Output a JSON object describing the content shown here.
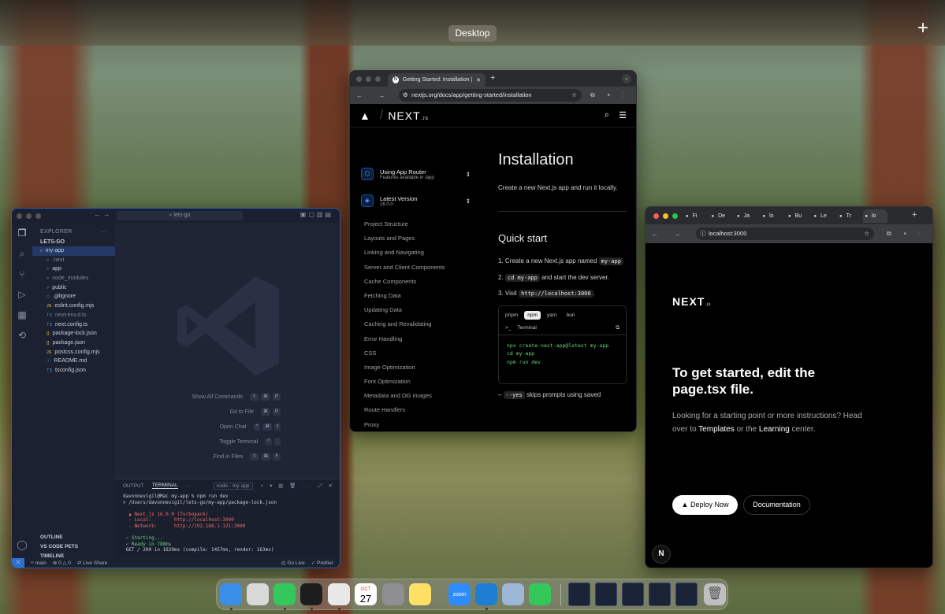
{
  "desktop": {
    "label": "Desktop",
    "plus": "+"
  },
  "vscode": {
    "search": "lets-go",
    "explorer_title": "EXPLORER",
    "root": "LETS-GO",
    "tree": [
      "my-app",
      ".next",
      "app",
      "node_modules",
      "public",
      ".gitignore",
      "eslint.config.mjs",
      "next-env.d.ts",
      "next.config.ts",
      "package-lock.json",
      "package.json",
      "postcss.config.mjs",
      "README.md",
      "tsconfig.json"
    ],
    "tree_icons": [
      "v",
      ">",
      ">",
      ">",
      ">",
      "◇",
      "JS",
      "TS",
      "TS",
      "{}",
      "{}",
      "JS",
      "ⓘ",
      "TS"
    ],
    "shortcuts": [
      {
        "label": "Show All Commands",
        "keys": [
          "⇧",
          "⌘",
          "P"
        ]
      },
      {
        "label": "Go to File",
        "keys": [
          "⌘",
          "P"
        ]
      },
      {
        "label": "Open Chat",
        "keys": [
          "^",
          "⌘",
          "I"
        ]
      },
      {
        "label": "Toggle Terminal",
        "keys": [
          "^",
          "`"
        ]
      },
      {
        "label": "Find in Files",
        "keys": [
          "⇧",
          "⌘",
          "F"
        ]
      }
    ],
    "panel_tabs": {
      "output": "OUTPUT",
      "terminal": "TERMINAL",
      "more": "···",
      "term_name": "node - my-app"
    },
    "terminal_lines": [
      "davonnevigil@Mac my-app % npm run dev",
      "> /Users/davonnevigil/lets-go/my-app/package-lock.json",
      "",
      "  ▲ Next.js 16.0.0 (Turbopack)",
      "  - Local:        http://localhost:3000",
      "  - Network:      http://192.168.1.121:3000",
      "",
      " ✓ Starting...",
      " ✓ Ready in 788ms",
      " GET / 200 in 1620ms (compile: 1457ms, render: 163ms)"
    ],
    "outline": [
      "OUTLINE",
      "VS CODE PETS",
      "TIMELINE"
    ],
    "status": {
      "branch": "main",
      "liveshare": "Live Share",
      "golive": "Go Live",
      "prettier": "Prettier"
    }
  },
  "docs_browser": {
    "tab_title": "Getting Started: Installation |",
    "url": "nextjs.org/docs/app/getting-started/installation",
    "brand": "NEXT",
    "brand_suffix": ".JS",
    "router_select": {
      "title": "Using App Router",
      "sub": "Features available in /app"
    },
    "version_select": {
      "title": "Latest Version",
      "sub": "16.0.0"
    },
    "nav": [
      "Project Structure",
      "Layouts and Pages",
      "Linking and Navigating",
      "Server and Client Components",
      "Cache Components",
      "Fetching Data",
      "Updating Data",
      "Caching and Revalidating",
      "Error Handling",
      "CSS",
      "Image Optimization",
      "Font Optimization",
      "Metadata and OG images",
      "Route Handlers",
      "Proxy"
    ],
    "title": "Installation",
    "intro": "Create a new Next.js app and run it locally.",
    "quick_start": "Quick start",
    "steps": [
      {
        "num": "1.",
        "pre": "Create a new Next.js app named ",
        "code": "my-app",
        "post": ""
      },
      {
        "num": "2.",
        "pre": "",
        "code": "cd my-app",
        "post": " and start the dev server."
      },
      {
        "num": "3.",
        "pre": "Visit ",
        "code": "http://localhost:3000",
        "post": "."
      }
    ],
    "pm_tabs": [
      "pnpm",
      "npm",
      "yarn",
      "bun"
    ],
    "pm_selected": "npm",
    "terminal_label": "Terminal",
    "commands": [
      "npx create-next-app@latest my-app",
      "cd my-app",
      "npm run dev"
    ],
    "bottom_code": "--yes",
    "bottom_text": " skips prompts using saved"
  },
  "local_browser": {
    "tabs": [
      "Fi",
      "De",
      "Ja",
      "lo",
      "Bu",
      "Le",
      "Tr",
      "lo"
    ],
    "url": "localhost:3000",
    "logo": "NEXT",
    "logo_suffix": ".js",
    "heading": "To get started, edit the page.tsx file.",
    "desc_1": "Looking for a starting point or more instructions? Head over to ",
    "templates": "Templates",
    "desc_2": " or the ",
    "learning": "Learning",
    "desc_3": " center.",
    "deploy": "Deploy Now",
    "docs": "Documentation",
    "badge": "N"
  },
  "dock": {
    "apps": [
      {
        "name": "Finder",
        "color": "#3b8fe8"
      },
      {
        "name": "Launchpad",
        "color": "#d9d9d9"
      },
      {
        "name": "Messages",
        "color": "#34c759"
      },
      {
        "name": "Terminal",
        "color": "#1d1d1d"
      },
      {
        "name": "Chrome",
        "color": "#e8e8e8"
      },
      {
        "name": "Calendar",
        "color": "#ffffff"
      },
      {
        "name": "Settings",
        "color": "#8e8e93"
      },
      {
        "name": "Notes",
        "color": "#ffe066"
      },
      {
        "name": "Zoom",
        "color": "#2d8cff"
      },
      {
        "name": "VS Code",
        "color": "#1f7ed1"
      },
      {
        "name": "Preview",
        "color": "#9fb7d6"
      },
      {
        "name": "FaceTime",
        "color": "#34c759"
      }
    ],
    "calendar_month": "OCT",
    "calendar_day": "27",
    "zoom_label": "zoom"
  }
}
